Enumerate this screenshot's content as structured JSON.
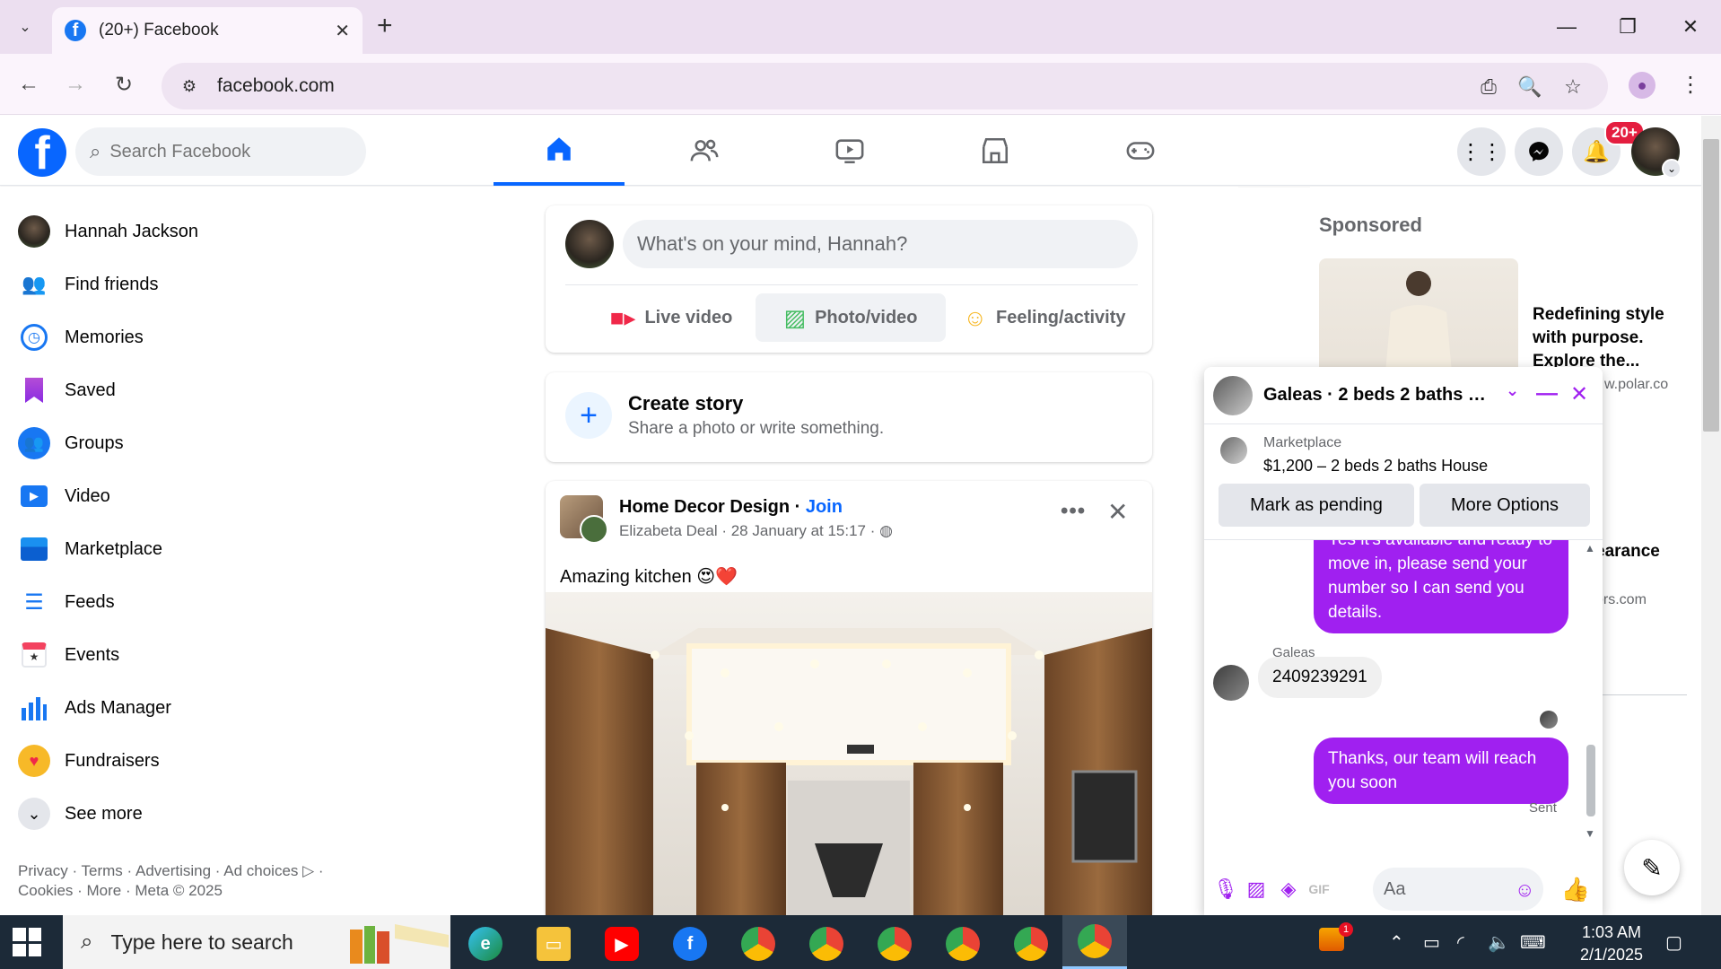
{
  "browser": {
    "tab_title": "(20+) Facebook",
    "url": "facebook.com"
  },
  "fb_nav": {
    "search_placeholder": "Search Facebook",
    "notification_badge": "20+",
    "tabs": [
      "home",
      "friends",
      "video",
      "marketplace",
      "gaming"
    ]
  },
  "sidebar": {
    "items": [
      {
        "label": "Hannah Jackson",
        "icon": "avatar"
      },
      {
        "label": "Find friends",
        "icon": "friends-icon"
      },
      {
        "label": "Memories",
        "icon": "clock-icon"
      },
      {
        "label": "Saved",
        "icon": "bookmark-icon"
      },
      {
        "label": "Groups",
        "icon": "groups-icon"
      },
      {
        "label": "Video",
        "icon": "video-icon"
      },
      {
        "label": "Marketplace",
        "icon": "store-icon"
      },
      {
        "label": "Feeds",
        "icon": "feeds-icon"
      },
      {
        "label": "Events",
        "icon": "calendar-icon"
      },
      {
        "label": "Ads Manager",
        "icon": "bar-chart-icon"
      },
      {
        "label": "Fundraisers",
        "icon": "heart-icon"
      },
      {
        "label": "See more",
        "icon": "chevron-down-icon"
      }
    ],
    "footer_line1": "Privacy · Terms · Advertising · Ad choices ▷ ·",
    "footer_line2": "Cookies · More · Meta © 2025"
  },
  "composer": {
    "placeholder": "What's on your mind, Hannah?",
    "live_video": "Live video",
    "photo_video": "Photo/video",
    "feeling": "Feeling/activity"
  },
  "story": {
    "title": "Create story",
    "subtitle": "Share a photo or write something."
  },
  "post": {
    "page_name": "Home Decor Design",
    "join": "Join",
    "author_meta": "Elizabeta Deal · 28 January at 15:17 ·",
    "text": "Amazing kitchen 😍❤️"
  },
  "sponsored": {
    "title": "Sponsored",
    "ad1_text": "Redefining style with purpose. Explore the...",
    "ad1_url": "w.polar.co",
    "ad2_text": "earance",
    "ad2_url": "ors.com"
  },
  "chat": {
    "name": "Galeas · 2 beds 2 baths Ho...",
    "marketplace_label": "Marketplace",
    "listing": "$1,200 – 2 beds 2 baths House",
    "btn_pending": "Mark as pending",
    "btn_more": "More Options",
    "msg_out_1": "Yes it's available and ready to move in, please send your number so I can send you details.",
    "sender": "Galeas",
    "msg_in_1": "2409239291",
    "msg_out_2": "Thanks, our team will reach you soon",
    "sent_label": "Sent",
    "input_placeholder": "Aa"
  },
  "taskbar": {
    "search_placeholder": "Type here to search",
    "time": "1:03 AM",
    "date": "2/1/2025",
    "tray_badge": "1"
  },
  "colors": {
    "fb_blue": "#0866ff",
    "messenger_purple": "#a020f0",
    "taskbar": "#1c2a38"
  }
}
